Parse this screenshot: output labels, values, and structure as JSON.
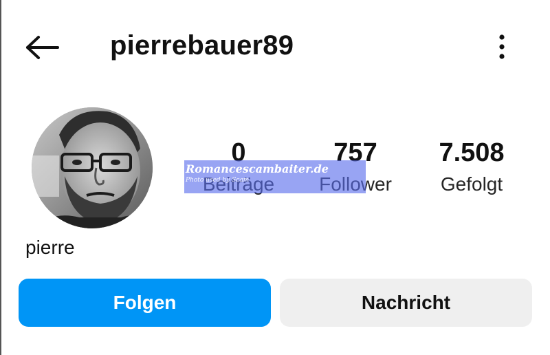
{
  "header": {
    "back_icon": "arrow-left-icon",
    "username": "pierrebauer89",
    "more_icon": "vertical-dots-icon"
  },
  "profile": {
    "avatar_alt": "profile photo",
    "display_name": "pierre",
    "stats": [
      {
        "value": "0",
        "label": "Beiträge"
      },
      {
        "value": "757",
        "label": "Follower"
      },
      {
        "value": "7.508",
        "label": "Gefolgt"
      }
    ]
  },
  "actions": {
    "follow_label": "Folgen",
    "message_label": "Nachricht"
  },
  "watermark": {
    "title": "Romancescambaiter.de",
    "subtitle": "Photo used by Scam"
  },
  "colors": {
    "follow_button": "#0095f6",
    "message_button": "#efefef",
    "watermark_overlay": "#586ceb"
  }
}
